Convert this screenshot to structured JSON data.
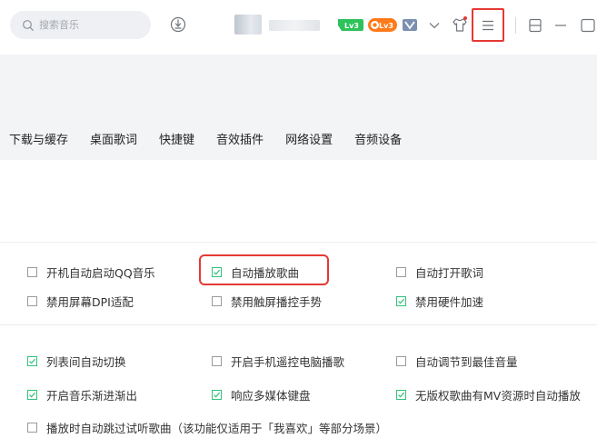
{
  "header": {
    "search_placeholder": "搜索音乐",
    "badges": {
      "level": "Lv3",
      "orange": "Lv3"
    },
    "colors": {
      "accent": "#31c27c",
      "highlight": "#e53935",
      "badge_green": "#2ec25b",
      "badge_orange": "#ff7a1a",
      "badge_blue": "#7b8fb0"
    }
  },
  "tabs": [
    {
      "label": "下载与缓存"
    },
    {
      "label": "桌面歌词"
    },
    {
      "label": "快捷键"
    },
    {
      "label": "音效插件"
    },
    {
      "label": "网络设置"
    },
    {
      "label": "音频设备"
    }
  ],
  "settings": {
    "group1": [
      {
        "label": "开机自动启动QQ音乐",
        "checked": false
      },
      {
        "label": "自动播放歌曲",
        "checked": true
      },
      {
        "label": "自动打开歌词",
        "checked": false
      },
      {
        "label": "禁用屏幕DPI适配",
        "checked": false
      },
      {
        "label": "禁用触屏播控手势",
        "checked": false
      },
      {
        "label": "禁用硬件加速",
        "checked": true
      }
    ],
    "group2": [
      {
        "label": "列表间自动切换",
        "checked": true
      },
      {
        "label": "开启手机遥控电脑播歌",
        "checked": false
      },
      {
        "label": "自动调节到最佳音量",
        "checked": false
      },
      {
        "label": "开启音乐渐进渐出",
        "checked": true
      },
      {
        "label": "响应多媒体键盘",
        "checked": true
      },
      {
        "label": "无版权歌曲有MV资源时自动播放",
        "checked": true
      },
      {
        "label": "播放时自动跳过试听歌曲（该功能仅适用于「我喜欢」等部分场景）",
        "checked": false
      }
    ]
  }
}
